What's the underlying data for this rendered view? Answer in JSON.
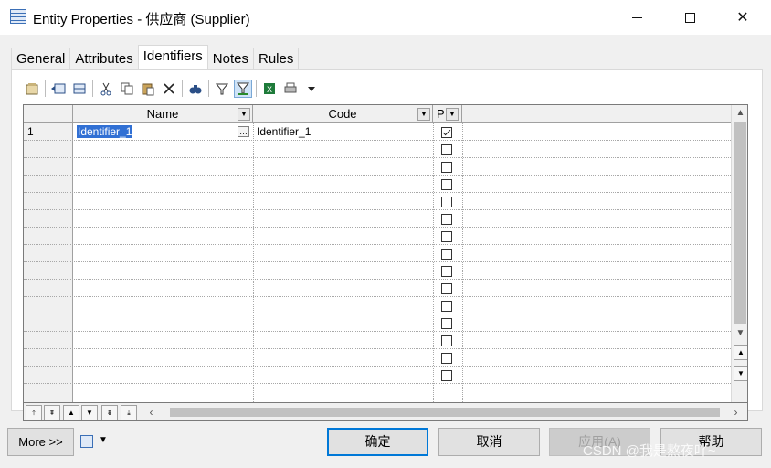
{
  "window": {
    "title": "Entity Properties - 供应商 (Supplier)",
    "controls": {
      "minimize_icon": "minimize-icon",
      "maximize_icon": "maximize-icon",
      "close_glyph": "✕"
    }
  },
  "tabs": [
    {
      "label": "General",
      "active": false
    },
    {
      "label": "Attributes",
      "active": false
    },
    {
      "label": "Identifiers",
      "active": true
    },
    {
      "label": "Notes",
      "active": false
    },
    {
      "label": "Rules",
      "active": false
    }
  ],
  "toolbar": {
    "buttons": [
      "properties-icon",
      "insert-row-icon",
      "add-row-icon",
      "cut-icon",
      "copy-icon",
      "paste-icon",
      "delete-icon",
      "find-icon",
      "filter-icon",
      "customize-columns-icon",
      "excel-export-icon",
      "print-icon",
      "dropdown-arrow-icon"
    ]
  },
  "grid": {
    "columns": [
      "Name",
      "Code",
      "P"
    ],
    "rows": [
      {
        "num": "1",
        "name": "Identifier_1",
        "code": "Identifier_1",
        "primary": true
      }
    ],
    "empty_rows": 14
  },
  "footer": {
    "more_label": "More >>",
    "ok_label": "确定",
    "cancel_label": "取消",
    "apply_label": "应用(A)",
    "help_label": "帮助"
  },
  "watermark": "CSDN @我是熬夜吖~"
}
